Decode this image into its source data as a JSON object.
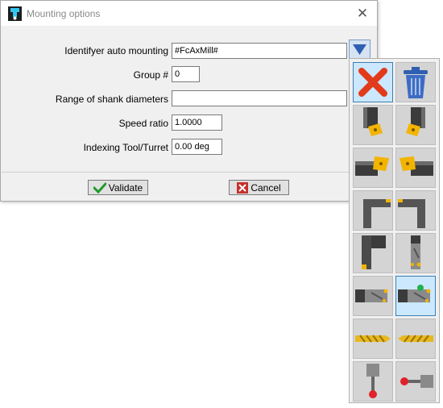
{
  "window": {
    "title": "Mounting options",
    "close_glyph": "✕"
  },
  "form": {
    "identifier_label": "Identifyer auto mounting",
    "identifier_value": "#FcAxMill#",
    "group_label": "Group #",
    "group_value": "0",
    "shank_label": "Range of shank diameters",
    "shank_value": "",
    "speed_label": "Speed ratio",
    "speed_value": "1.0000",
    "indexing_label": "Indexing Tool/Turret",
    "indexing_value": "0.00 deg"
  },
  "buttons": {
    "validate_label": "Validate",
    "cancel_label": "Cancel"
  },
  "palette": {
    "selected_item": "boring-bar-inner-tool-icon",
    "items": [
      "red-x-icon",
      "trash-can-icon",
      "turning-holder-left-icon",
      "turning-holder-right-icon",
      "turning-holder-side-left-icon",
      "turning-holder-side-right-icon",
      "grooving-tool-left-icon",
      "grooving-tool-right-icon",
      "parting-tool-left-icon",
      "boring-bar-icon",
      "boring-bar-outer-icon",
      "boring-bar-inner-tool-icon",
      "drill-left-icon",
      "drill-right-icon",
      "probe-vertical-icon",
      "probe-horizontal-icon"
    ]
  },
  "colors": {
    "accent_blue": "#2f5fb0",
    "validate_green": "#1f9a2b",
    "cancel_red": "#c4302b",
    "insert_yellow": "#f2b400",
    "selection_bg": "#cce8ff"
  }
}
